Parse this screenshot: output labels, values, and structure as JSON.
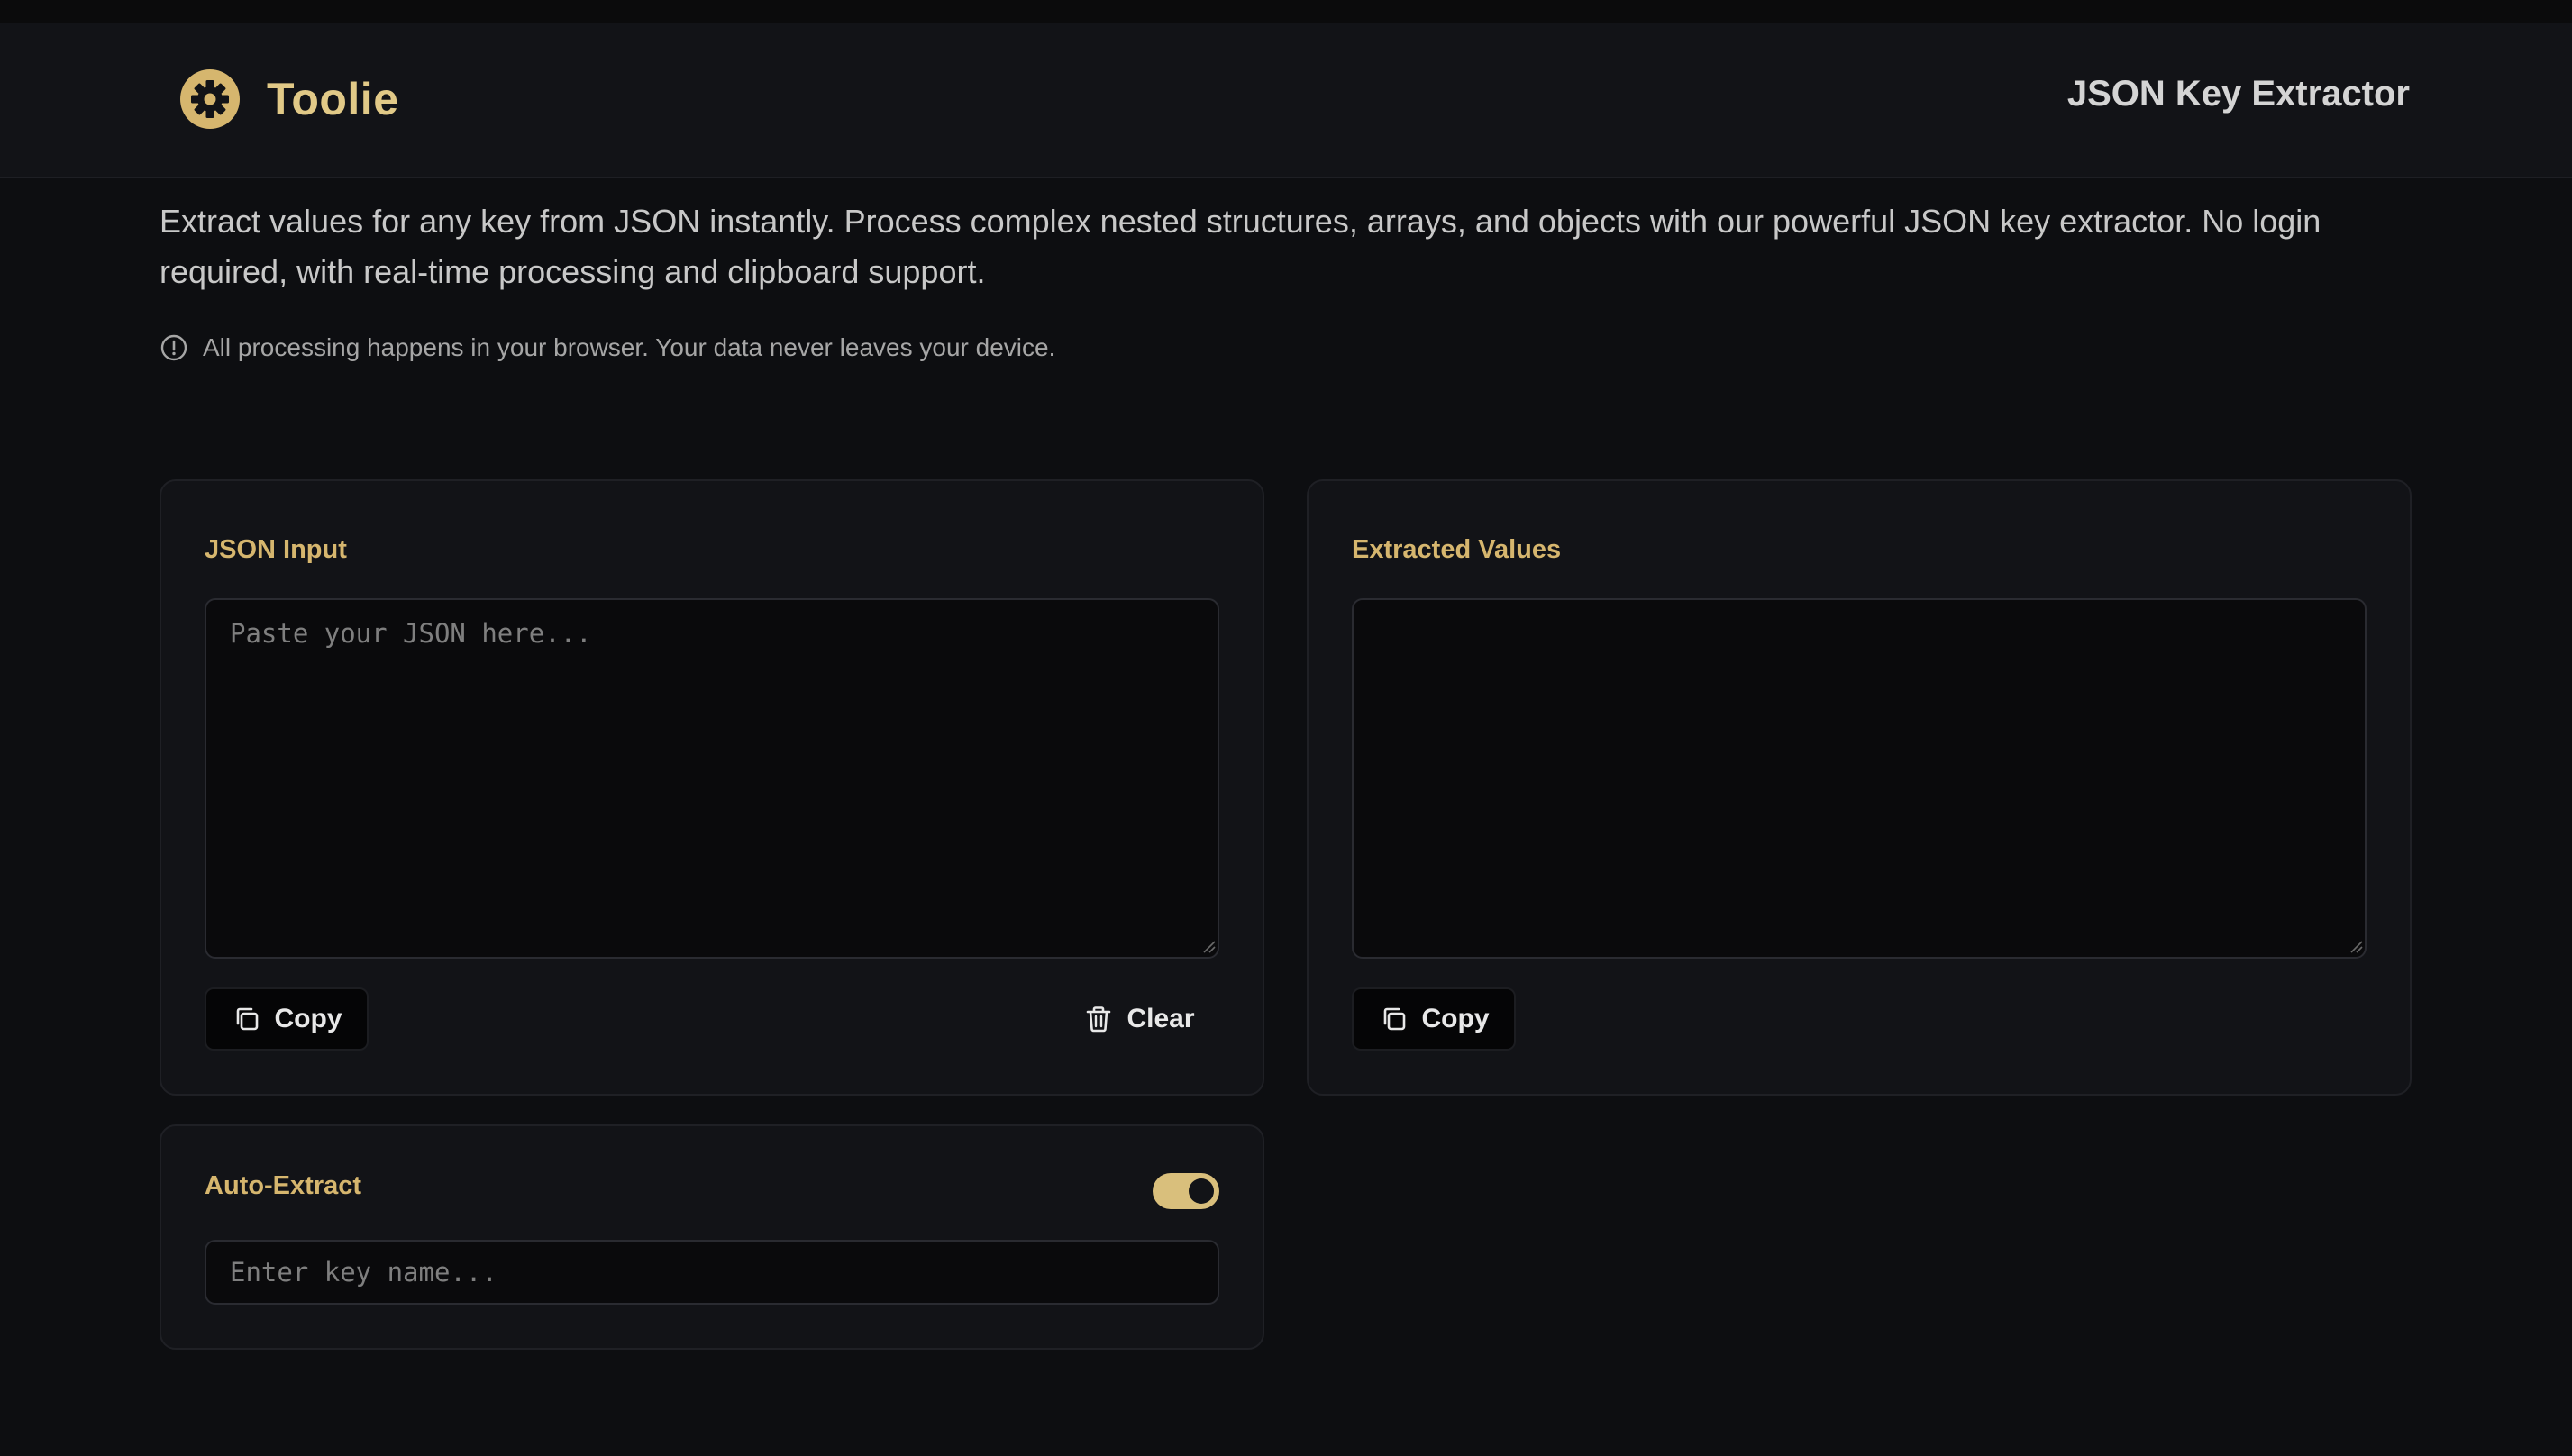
{
  "brand": {
    "name": "Toolie",
    "icon": "gear-icon",
    "accent": "#d6b66e"
  },
  "header": {
    "tool_title": "JSON Key Extractor"
  },
  "intro": {
    "description": "Extract values for any key from JSON instantly. Process complex nested structures, arrays, and objects with our powerful JSON key extractor. No login required, with real-time processing and clipboard support.",
    "privacy_note": "All processing happens in your browser. Your data never leaves your device.",
    "privacy_icon": "info-circle-icon"
  },
  "input_panel": {
    "label": "JSON Input",
    "placeholder": "Paste your JSON here...",
    "value": "",
    "copy_label": "Copy",
    "copy_icon": "copy-icon",
    "clear_label": "Clear",
    "clear_icon": "trash-icon"
  },
  "output_panel": {
    "label": "Extracted Values",
    "value": "",
    "copy_label": "Copy",
    "copy_icon": "copy-icon"
  },
  "auto_extract": {
    "label": "Auto-Extract",
    "enabled": true,
    "key_placeholder": "Enter key name...",
    "key_value": ""
  }
}
